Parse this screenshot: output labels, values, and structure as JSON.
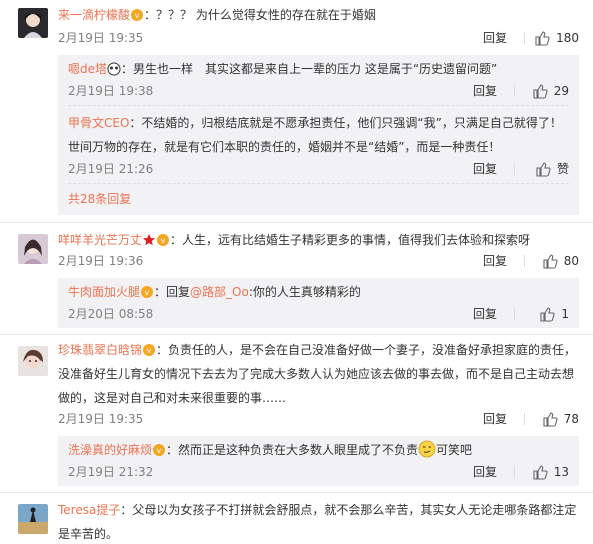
{
  "comments": [
    {
      "user": "来一滴柠檬酸",
      "text": "：？？？ 为什么觉得女性的存在就在于婚姻",
      "time": "2月19日 19:35",
      "reply_label": "回复",
      "likes": "180",
      "replies": [
        {
          "user": "嗯de塔",
          "text": "：男生也一样　其实这都是来自上一辈的压力 这是属于“历史遗留问题”",
          "time": "2月19日 19:38",
          "reply_label": "回复",
          "likes": "29"
        },
        {
          "user": "甲骨文CEO",
          "text": "：不结婚的，归根结底就是不愿承担责任，他们只强调“我”，只满足自己就得了！世间万物的存在，就是有它们本职的责任的，婚姻并不是“结婚”，而是一种责任！",
          "time": "2月19日 21:26",
          "reply_label": "回复",
          "likes": "赞"
        }
      ],
      "more_replies": "共28条回复"
    },
    {
      "user": "咩咩羊光芒万丈",
      "text": "：人生，远有比结婚生子精彩更多的事情，值得我们去体验和探索呀",
      "time": "2月19日 19:36",
      "reply_label": "回复",
      "likes": "80",
      "replies": [
        {
          "user": "牛肉面加火腿",
          "text_prefix": "：回复",
          "mention": "@路部_Oo",
          "text": ":你的人生真够精彩的",
          "time": "2月20日 08:58",
          "reply_label": "回复",
          "likes": "1"
        }
      ]
    },
    {
      "user": "珍珠翡翠白晗锦",
      "text": "：负责任的人，是不会在自己没准备好做一个妻子，没准备好承担家庭的责任，没准备好生儿育女的情况下去去为了完成大多数人认为她应该去做的事去做，而不是自己主动去想做的，这是对自己和对未来很重要的事……",
      "time": "2月19日 19:35",
      "reply_label": "回复",
      "likes": "78",
      "replies": [
        {
          "user": "洗澡真的好麻烦",
          "text": "：然而正是这种负责在大多数人眼里成了不负责",
          "text_suffix": "可笑吧",
          "time": "2月19日 21:32",
          "reply_label": "回复",
          "likes": "13"
        }
      ]
    },
    {
      "user": "Teresa提子",
      "text": "：父母以为女孩子不打拼就会舒服点，就不会那么辛苦，其实女人无论走哪条路都注定是辛苦的。"
    }
  ],
  "colors": {
    "accent": "#eb7350",
    "subbg": "#f2f2f5",
    "meta": "#808080"
  }
}
